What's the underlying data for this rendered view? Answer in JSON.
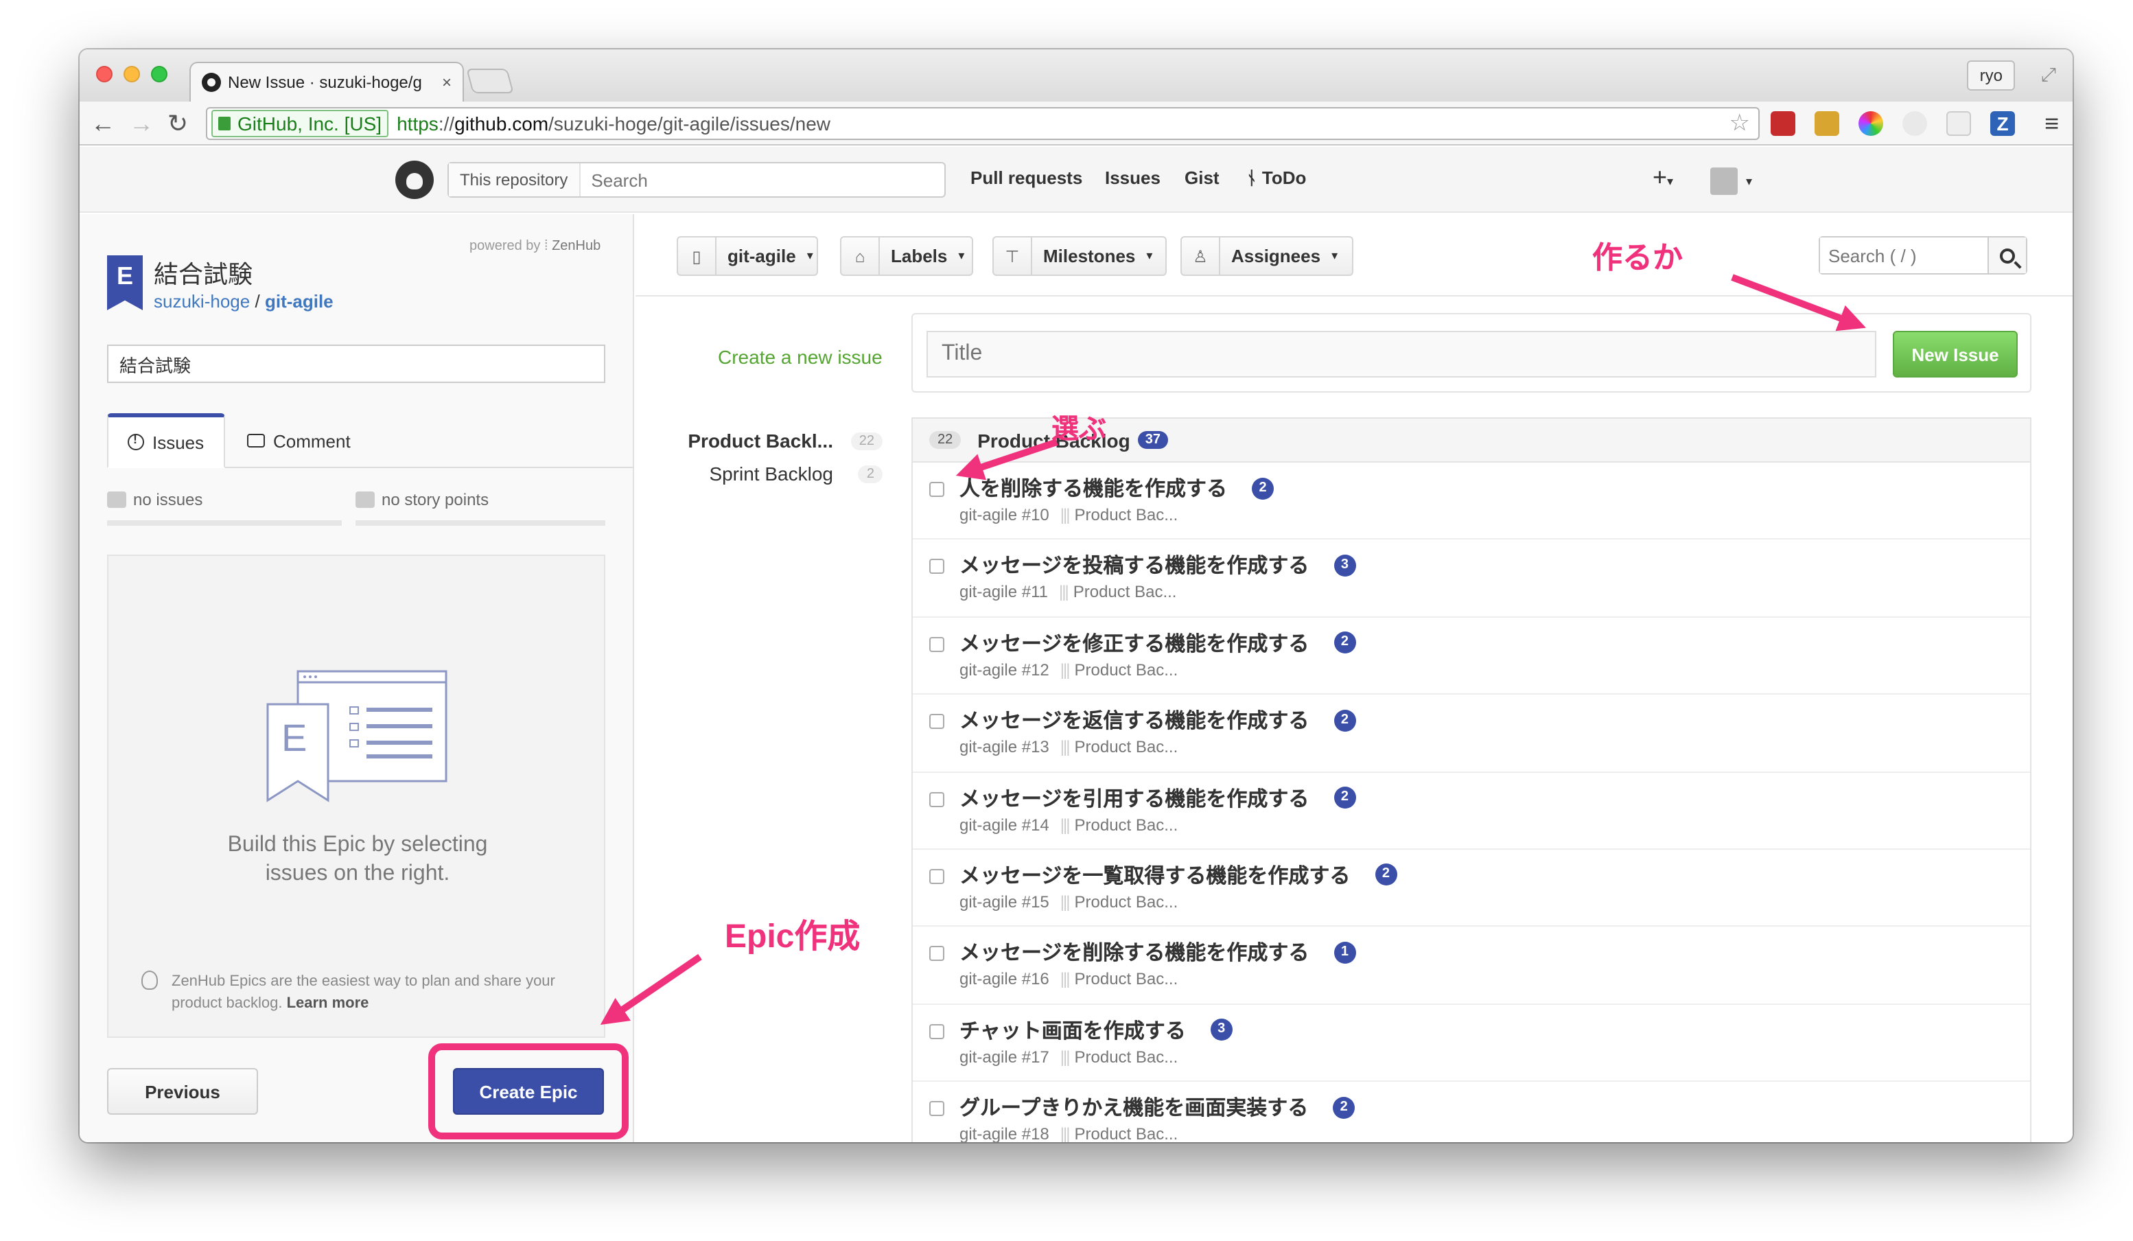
{
  "browser": {
    "tab_title": "New Issue · suzuki-hoge/g",
    "tab_close": "×",
    "profile": "ryo",
    "ev_label": "GitHub, Inc. [US]",
    "url_scheme": "https",
    "url_host": "github.com",
    "url_path": "/suzuki-hoge/git-agile/issues/new",
    "back": "←",
    "forward": "→",
    "reload": "↻",
    "star": "☆",
    "menu": "≡"
  },
  "github_header": {
    "scope_label": "This repository",
    "search_placeholder": "Search",
    "nav": [
      "Pull requests",
      "Issues",
      "Gist",
      "ToDo"
    ],
    "todo_icon": "ᚾ",
    "plus": "+",
    "caret": "▾"
  },
  "sidebar": {
    "powered_prefix": "powered by",
    "powered_brand": "ZenHub",
    "epic_badge": "E",
    "epic_title": "結合試験",
    "repo_owner": "suzuki-hoge",
    "repo_sep": "/",
    "repo_name": "git-agile",
    "title_value": "結合試験",
    "tabs": [
      "Issues",
      "Comment"
    ],
    "stat_issues": "no issues",
    "stat_points": "no story points",
    "empty_line1": "Build this Epic by selecting",
    "empty_line2": "issues on the right.",
    "hint_text": "ZenHub Epics are the easiest way to plan and share your product backlog.",
    "hint_link": "Learn more",
    "previous_label": "Previous",
    "create_label": "Create Epic"
  },
  "filters": {
    "buttons": [
      "git-agile",
      "Labels",
      "Milestones",
      "Assignees"
    ],
    "search_placeholder": "Search ( / )"
  },
  "create_issue": {
    "label": "Create a new issue",
    "title_placeholder": "Title",
    "button": "New Issue"
  },
  "pipelines": [
    {
      "name": "Product Backl...",
      "count": "22"
    },
    {
      "name": "Sprint Backlog",
      "count": "2"
    }
  ],
  "issue_list": {
    "header_count": "22",
    "header_name": "Product Backlog",
    "header_badge": "37",
    "issues": [
      {
        "title": "人を削除する機能を作成する",
        "estimate": "2",
        "ref": "git-agile #10",
        "pipeline": "Product Bac..."
      },
      {
        "title": "メッセージを投稿する機能を作成する",
        "estimate": "3",
        "ref": "git-agile #11",
        "pipeline": "Product Bac..."
      },
      {
        "title": "メッセージを修正する機能を作成する",
        "estimate": "2",
        "ref": "git-agile #12",
        "pipeline": "Product Bac..."
      },
      {
        "title": "メッセージを返信する機能を作成する",
        "estimate": "2",
        "ref": "git-agile #13",
        "pipeline": "Product Bac..."
      },
      {
        "title": "メッセージを引用する機能を作成する",
        "estimate": "2",
        "ref": "git-agile #14",
        "pipeline": "Product Bac..."
      },
      {
        "title": "メッセージを一覧取得する機能を作成する",
        "estimate": "2",
        "ref": "git-agile #15",
        "pipeline": "Product Bac..."
      },
      {
        "title": "メッセージを削除する機能を作成する",
        "estimate": "1",
        "ref": "git-agile #16",
        "pipeline": "Product Bac..."
      },
      {
        "title": "チャット画面を作成する",
        "estimate": "3",
        "ref": "git-agile #17",
        "pipeline": "Product Bac..."
      },
      {
        "title": "グループきりかえ機能を画面実装する",
        "estimate": "2",
        "ref": "git-agile #18",
        "pipeline": "Product Bac..."
      }
    ]
  },
  "annotations": {
    "make_or_not": "作るか",
    "select": "選ぶ",
    "create_epic": "Epic作成",
    "color": "#f0327d"
  }
}
